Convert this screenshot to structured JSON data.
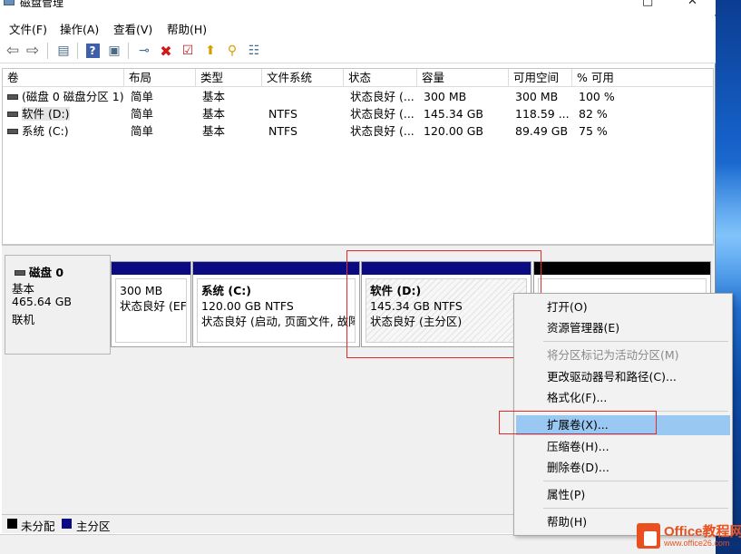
{
  "window": {
    "title": "磁盘管理",
    "controls": [
      "—",
      "□",
      "✕"
    ]
  },
  "menubar": [
    {
      "label": "文件(F)"
    },
    {
      "label": "操作(A)"
    },
    {
      "label": "查看(V)"
    },
    {
      "label": "帮助(H)"
    }
  ],
  "toolbar": [
    {
      "icon": "back-arrow-icon",
      "glyph": "⇦",
      "color": "#5a5a5a"
    },
    {
      "icon": "forward-arrow-icon",
      "glyph": "⇨",
      "color": "#5a5a5a"
    },
    {
      "icon": "console-tree-icon",
      "glyph": "▤",
      "color": "#4a6a8a"
    },
    {
      "icon": "help-icon",
      "glyph": "?",
      "color": "#ffffff"
    },
    {
      "icon": "properties-icon",
      "glyph": "▣",
      "color": "#4a6a8a"
    },
    {
      "icon": "connect-icon",
      "glyph": "⊸",
      "color": "#4a6a8a"
    },
    {
      "icon": "delete-icon",
      "glyph": "✖",
      "color": "#d01818"
    },
    {
      "icon": "check-icon",
      "glyph": "☑",
      "color": "#c02020"
    },
    {
      "icon": "up-icon",
      "glyph": "⬆",
      "color": "#d4a000"
    },
    {
      "icon": "search-icon",
      "glyph": "⚲",
      "color": "#d4a000"
    },
    {
      "icon": "settings-icon",
      "glyph": "☷",
      "color": "#4a6a8a"
    }
  ],
  "volume_table": {
    "headers": [
      "卷",
      "布局",
      "类型",
      "文件系统",
      "状态",
      "容量",
      "可用空间",
      "% 可用"
    ],
    "rows": [
      [
        "(磁盘 0 磁盘分区 1)",
        "简单",
        "基本",
        "",
        "状态良好 (...",
        "300 MB",
        "300 MB",
        "100 %"
      ],
      [
        "软件 (D:)",
        "简单",
        "基本",
        "NTFS",
        "状态良好 (...",
        "145.34 GB",
        "118.59 ...",
        "82 %"
      ],
      [
        "系统 (C:)",
        "简单",
        "基本",
        "NTFS",
        "状态良好 (...",
        "120.00 GB",
        "89.49 GB",
        "75 %"
      ]
    ]
  },
  "disk": {
    "name": "磁盘 0",
    "type": "基本",
    "size": "465.64 GB",
    "status": "联机"
  },
  "partitions": [
    {
      "name": "",
      "size": "300 MB",
      "status": "状态良好 (EFI"
    },
    {
      "name": "系统 (C:)",
      "size": "120.00 GB NTFS",
      "status": "状态良好 (启动, 页面文件, 故障"
    },
    {
      "name": "软件 (D:)",
      "size": "145.34 GB NTFS",
      "status": "状态良好 (主分区)"
    }
  ],
  "legend": [
    {
      "label": "未分配",
      "color": "#000000"
    },
    {
      "label": "主分区",
      "color": "#0a0a82"
    }
  ],
  "context_menu": [
    {
      "label": "打开(O)",
      "disabled": false
    },
    {
      "label": "资源管理器(E)",
      "disabled": false
    },
    {
      "label": "将分区标记为活动分区(M)",
      "disabled": true
    },
    {
      "label": "更改驱动器号和路径(C)...",
      "disabled": false
    },
    {
      "label": "格式化(F)...",
      "disabled": false
    },
    {
      "label": "扩展卷(X)...",
      "disabled": false,
      "highlighted": true
    },
    {
      "label": "压缩卷(H)...",
      "disabled": false
    },
    {
      "label": "删除卷(D)...",
      "disabled": false
    },
    {
      "label": "属性(P)",
      "disabled": false
    },
    {
      "label": "帮助(H)",
      "disabled": false
    }
  ],
  "watermark": {
    "brand": "Office教程网",
    "site": "www.office26.com"
  },
  "colors": {
    "highlight": "#99c9f3",
    "primary_partition": "#0a0a82",
    "annotation": "#e52a2a"
  }
}
